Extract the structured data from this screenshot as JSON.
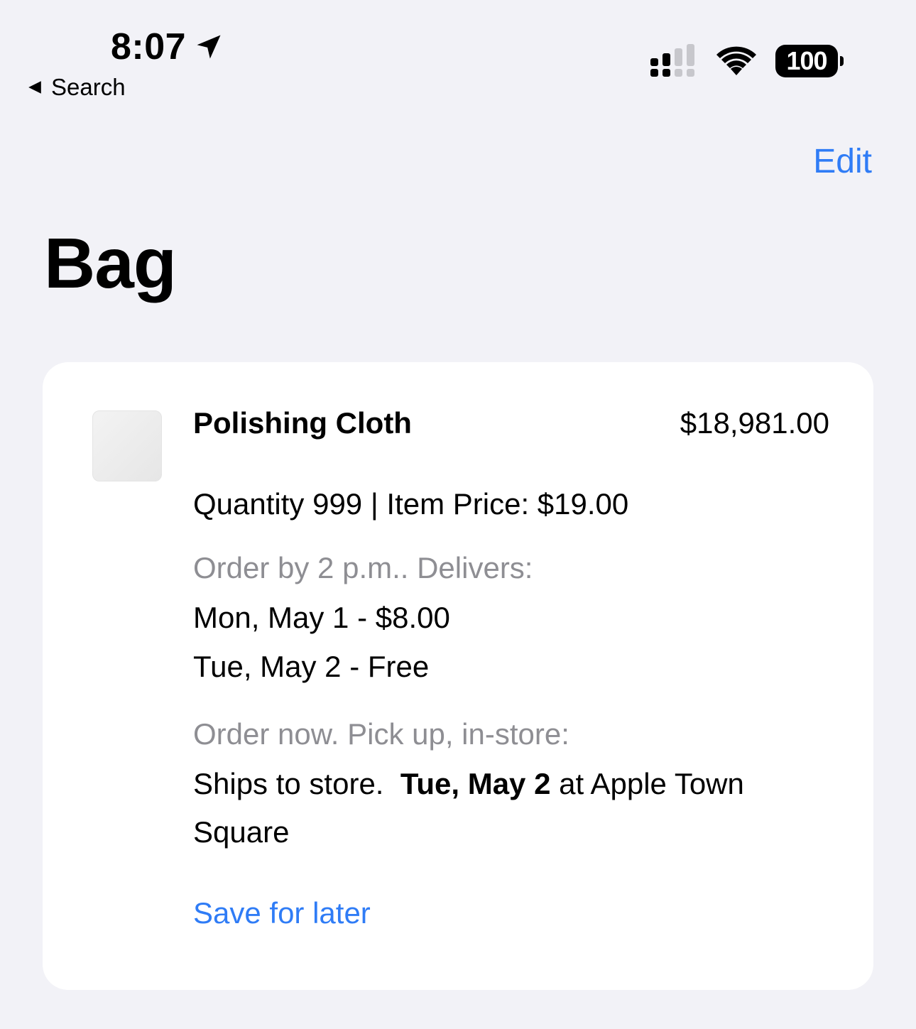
{
  "status_bar": {
    "time": "8:07",
    "back_label": "Search",
    "battery": "100"
  },
  "nav": {
    "edit_label": "Edit",
    "title": "Bag"
  },
  "item": {
    "name": "Polishing Cloth",
    "total_price": "$18,981.00",
    "quantity_line": "Quantity 999 | Item Price: $19.00",
    "delivery_heading": "Order by 2 p.m.. Delivers:",
    "delivery_options": [
      "Mon, May 1 - $8.00",
      "Tue, May 2 - Free"
    ],
    "pickup_heading": "Order now. Pick up, in-store:",
    "pickup_prefix": "Ships to store.",
    "pickup_date": "Tue, May 2",
    "pickup_suffix": "at Apple Town",
    "pickup_store_cont": "Square",
    "save_label": "Save for later"
  },
  "colors": {
    "accent": "#2f7cf6",
    "background": "#f2f2f7",
    "secondary_text": "#8e8e93"
  }
}
